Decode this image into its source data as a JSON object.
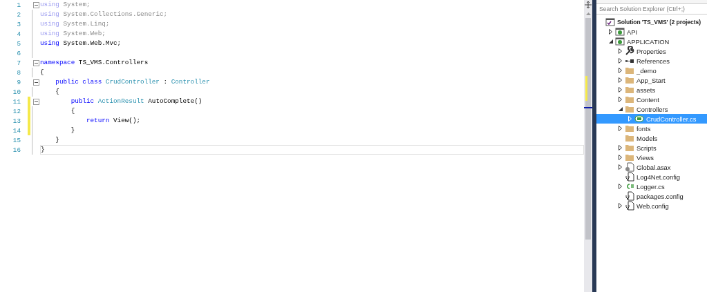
{
  "editor": {
    "lines": [
      {
        "number": "1",
        "fold": true,
        "faded": true,
        "tokens": [
          {
            "kind": "kw",
            "text": "using"
          },
          {
            "kind": "text",
            "text": " System;"
          }
        ]
      },
      {
        "number": "2",
        "faded": true,
        "tokens": [
          {
            "kind": "kw",
            "text": "using"
          },
          {
            "kind": "text",
            "text": " System.Collections.Generic;"
          }
        ]
      },
      {
        "number": "3",
        "faded": true,
        "tokens": [
          {
            "kind": "kw",
            "text": "using"
          },
          {
            "kind": "text",
            "text": " System.Linq;"
          }
        ]
      },
      {
        "number": "4",
        "faded": true,
        "tokens": [
          {
            "kind": "kw",
            "text": "using"
          },
          {
            "kind": "text",
            "text": " System.Web;"
          }
        ]
      },
      {
        "number": "5",
        "tokens": [
          {
            "kind": "kw",
            "text": "using"
          },
          {
            "kind": "text",
            "text": " System.Web.Mvc;"
          }
        ]
      },
      {
        "number": "6"
      },
      {
        "number": "7",
        "fold": true,
        "tokens": [
          {
            "kind": "kw",
            "text": "namespace"
          },
          {
            "kind": "text",
            "text": " TS_VMS.Controllers"
          }
        ]
      },
      {
        "number": "8",
        "tokens": [
          {
            "kind": "text",
            "text": "{"
          }
        ]
      },
      {
        "number": "9",
        "fold": true,
        "tokens": [
          {
            "kind": "kw",
            "text": "    public class"
          },
          {
            "kind": "type",
            "text": " CrudController"
          },
          {
            "kind": "text",
            "text": " :"
          },
          {
            "kind": "type",
            "text": " Controller"
          }
        ]
      },
      {
        "number": "10",
        "tokens": [
          {
            "kind": "text",
            "text": "    {"
          }
        ]
      },
      {
        "number": "11",
        "fold": true,
        "changed": true,
        "tokens": [
          {
            "kind": "kw",
            "text": "        public"
          },
          {
            "kind": "type",
            "text": " ActionResult"
          },
          {
            "kind": "text",
            "text": " AutoComplete()"
          }
        ]
      },
      {
        "number": "12",
        "changed": true,
        "tokens": [
          {
            "kind": "text",
            "text": "        {"
          }
        ]
      },
      {
        "number": "13",
        "changed": true,
        "tokens": [
          {
            "kind": "kw",
            "text": "            return"
          },
          {
            "kind": "text",
            "text": " View();"
          }
        ]
      },
      {
        "number": "14",
        "changed": true,
        "tokens": [
          {
            "kind": "text",
            "text": "        }"
          }
        ]
      },
      {
        "number": "15",
        "tokens": [
          {
            "kind": "text",
            "text": "    }"
          }
        ]
      },
      {
        "number": "16",
        "current": true,
        "tokens": [
          {
            "kind": "text",
            "text": "}"
          }
        ]
      }
    ]
  },
  "solution_explorer": {
    "search": {
      "placeholder": "Search Solution Explorer (Ctrl+;)"
    },
    "tree": [
      {
        "label": "Solution 'TS_VMS' (2 projects)",
        "kind": "solution",
        "selected": false,
        "children": [
          {
            "label": "API",
            "kind": "project",
            "expanded": false,
            "selected": false
          },
          {
            "label": "APPLICATION",
            "kind": "project",
            "expanded": true,
            "selected": false,
            "children": [
              {
                "label": "Properties",
                "kind": "wrench",
                "expanded": false,
                "selected": false
              },
              {
                "label": "References",
                "kind": "references",
                "expanded": false,
                "selected": false
              },
              {
                "label": "_demo",
                "kind": "folder",
                "expanded": false,
                "selected": false
              },
              {
                "label": "App_Start",
                "kind": "folder",
                "expanded": false,
                "selected": false
              },
              {
                "label": "assets",
                "kind": "folder",
                "expanded": false,
                "selected": false
              },
              {
                "label": "Content",
                "kind": "folder",
                "expanded": false,
                "selected": false
              },
              {
                "label": "Controllers",
                "kind": "folder",
                "expanded": true,
                "selected": false,
                "children": [
                  {
                    "label": "CrudController.cs",
                    "kind": "class",
                    "expanded": false,
                    "selected": true
                  }
                ]
              },
              {
                "label": "fonts",
                "kind": "folder",
                "expanded": false,
                "selected": false
              },
              {
                "label": "Models",
                "kind": "folder",
                "selected": false
              },
              {
                "label": "Scripts",
                "kind": "folder",
                "expanded": false,
                "selected": false
              },
              {
                "label": "Views",
                "kind": "folder",
                "expanded": false,
                "selected": false
              },
              {
                "label": "Global.asax",
                "kind": "asax",
                "expanded": false,
                "selected": false
              },
              {
                "label": "Log4Net.config",
                "kind": "config",
                "selected": false
              },
              {
                "label": "Logger.cs",
                "kind": "cs",
                "expanded": false,
                "selected": false
              },
              {
                "label": "packages.config",
                "kind": "config",
                "selected": false
              },
              {
                "label": "Web.config",
                "kind": "config",
                "expanded": false,
                "selected": false
              }
            ]
          }
        ]
      }
    ]
  }
}
